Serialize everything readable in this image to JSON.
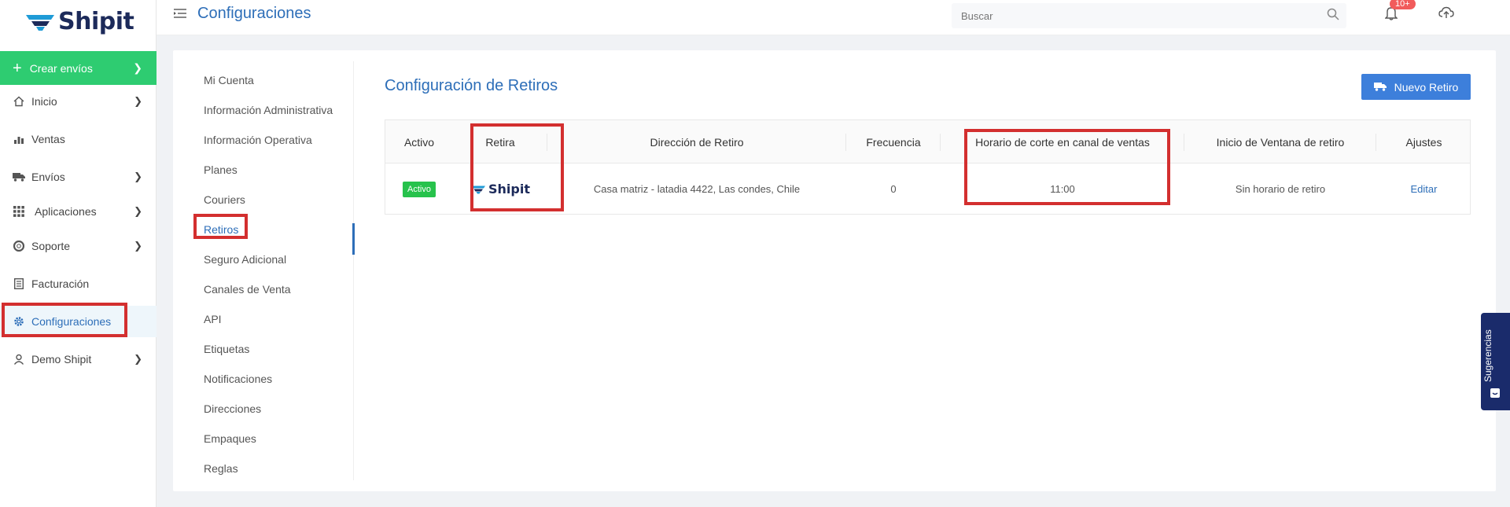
{
  "brand": {
    "name": "Shipit"
  },
  "sidebar": {
    "create": {
      "label": "Crear envíos"
    },
    "items": [
      {
        "label": "Inicio",
        "icon": "home-icon",
        "has_chevron": true
      },
      {
        "label": "Ventas",
        "icon": "sales-chart-icon",
        "has_chevron": false
      },
      {
        "label": "Envíos",
        "icon": "truck-icon",
        "has_chevron": true
      },
      {
        "label": "Aplicaciones",
        "icon": "grid-icon",
        "has_chevron": true
      },
      {
        "label": "Soporte",
        "icon": "lifebuoy-icon",
        "has_chevron": true
      },
      {
        "label": "Facturación",
        "icon": "invoice-icon",
        "has_chevron": false
      },
      {
        "label": "Configuraciones",
        "icon": "gear-icon",
        "has_chevron": false,
        "active": true
      },
      {
        "label": "Demo Shipit",
        "icon": "user-icon",
        "has_chevron": true
      }
    ]
  },
  "header": {
    "title": "Configuraciones",
    "search_placeholder": "Buscar",
    "notifications_badge": "10+"
  },
  "subnav": {
    "items": [
      {
        "label": "Mi Cuenta"
      },
      {
        "label": "Información Administrativa"
      },
      {
        "label": "Información Operativa"
      },
      {
        "label": "Planes"
      },
      {
        "label": "Couriers"
      },
      {
        "label": "Retiros",
        "active": true
      },
      {
        "label": "Seguro Adicional"
      },
      {
        "label": "Canales de Venta"
      },
      {
        "label": "API"
      },
      {
        "label": "Etiquetas"
      },
      {
        "label": "Notificaciones"
      },
      {
        "label": "Direcciones"
      },
      {
        "label": "Empaques"
      },
      {
        "label": "Reglas"
      }
    ]
  },
  "main": {
    "title": "Configuración de Retiros",
    "new_button": "Nuevo Retiro",
    "table": {
      "headers": [
        "Activo",
        "Retira",
        "Dirección de Retiro",
        "Frecuencia",
        "Horario de corte en canal de ventas",
        "Inicio de Ventana de retiro",
        "Ajustes"
      ],
      "row": {
        "status": "Activo",
        "courier_logo": "Shipit",
        "address": "Casa matriz - latadia 4422, Las condes, Chile",
        "frequency": "0",
        "cutoff": "11:00",
        "window": "Sin horario de retiro",
        "action": "Editar"
      }
    }
  },
  "feedback": {
    "label": "Sugerencias"
  },
  "colors": {
    "accent": "#2d6eb8",
    "green": "#2ecc71",
    "highlight": "#d32f2f",
    "navy": "#1c2a5a"
  }
}
